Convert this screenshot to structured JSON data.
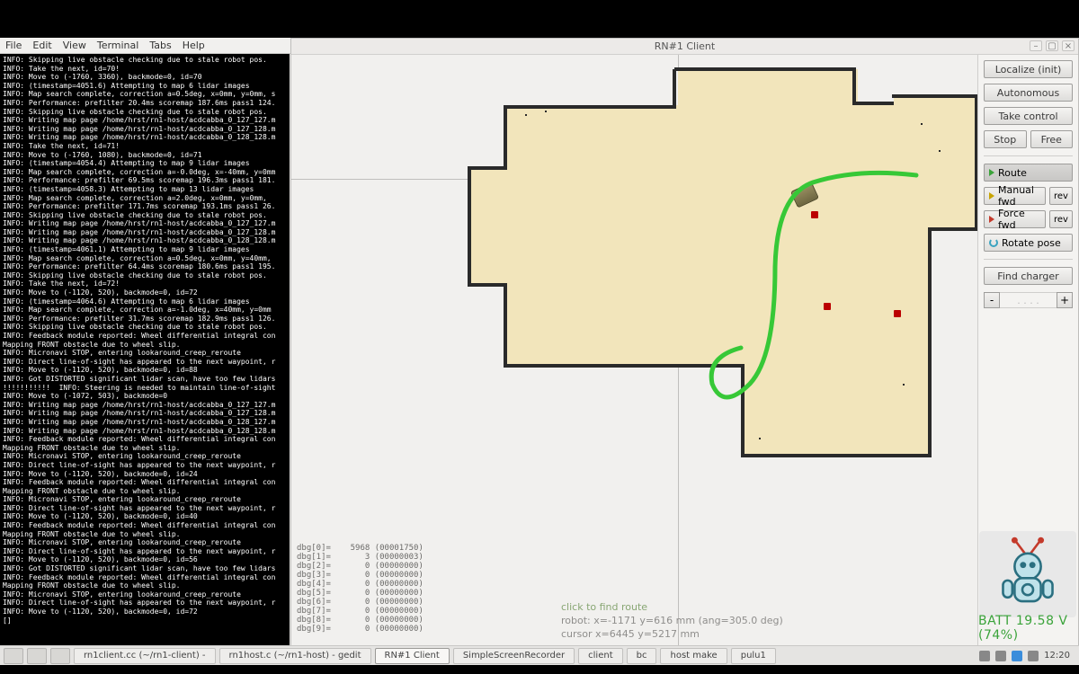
{
  "menubar": [
    "File",
    "Edit",
    "View",
    "Terminal",
    "Tabs",
    "Help"
  ],
  "client_title": "RN#1 Client",
  "terminal_log": "INFO: Skipping live obstacle checking due to stale robot pos.\nINFO: Take the next, id=70!\nINFO: Move to (-1760, 3360), backmode=0, id=70\nINFO: (timestamp=4051.6) Attempting to map 6 lidar images\nINFO: Map search complete, correction a=0.5deg, x=0mm, y=0mm, s\nINFO: Performance: prefilter 20.4ms scoremap 187.6ms pass1 124.\nINFO: Skipping live obstacle checking due to stale robot pos.\nINFO: Writing map page /home/hrst/rn1-host/acdcabba_0_127_127.m\nINFO: Writing map page /home/hrst/rn1-host/acdcabba_0_127_128.m\nINFO: Writing map page /home/hrst/rn1-host/acdcabba_0_128_128.m\nINFO: Take the next, id=71!\nINFO: Move to (-1760, 1080), backmode=0, id=71\nINFO: (timestamp=4054.4) Attempting to map 9 lidar images\nINFO: Map search complete, correction a=-0.0deg, x=-40mm, y=0mm\nINFO: Performance: prefilter 69.5ms scoremap 196.3ms pass1 181.\nINFO: (timestamp=4058.3) Attempting to map 13 lidar images\nINFO: Map search complete, correction a=2.0deg, x=0mm, y=0mm,\nINFO: Performance: prefilter 171.7ms scoremap 193.1ms pass1 26.\nINFO: Skipping live obstacle checking due to stale robot pos.\nINFO: Writing map page /home/hrst/rn1-host/acdcabba_0_127_127.m\nINFO: Writing map page /home/hrst/rn1-host/acdcabba_0_127_128.m\nINFO: Writing map page /home/hrst/rn1-host/acdcabba_0_128_128.m\nINFO: (timestamp=4061.1) Attempting to map 9 lidar images\nINFO: Map search complete, correction a=0.5deg, x=0mm, y=40mm,\nINFO: Performance: prefilter 64.4ms scoremap 180.6ms pass1 195.\nINFO: Skipping live obstacle checking due to stale robot pos.\nINFO: Take the next, id=72!\nINFO: Move to (-1120, 520), backmode=0, id=72\nINFO: (timestamp=4064.6) Attempting to map 6 lidar images\nINFO: Map search complete, correction a=-1.0deg, x=40mm, y=0mm\nINFO: Performance: prefilter 31.7ms scoremap 182.9ms pass1 126.\nINFO: Skipping live obstacle checking due to stale robot pos.\nINFO: Feedback module reported: Wheel differential integral con\nMapping FRONT obstacle due to wheel slip.\nINFO: Micronavi STOP, entering lookaround_creep_reroute\nINFO: Direct line-of-sight has appeared to the next waypoint, r\nINFO: Move to (-1120, 520), backmode=0, id=88\nINFO: Got DISTORTED significant lidar scan, have too few lidars\n!!!!!!!!!!!  INFO: Steering is needed to maintain line-of-sight\nINFO: Move to (-1072, 503), backmode=0\nINFO: Writing map page /home/hrst/rn1-host/acdcabba_0_127_127.m\nINFO: Writing map page /home/hrst/rn1-host/acdcabba_0_127_128.m\nINFO: Writing map page /home/hrst/rn1-host/acdcabba_0_128_127.m\nINFO: Writing map page /home/hrst/rn1-host/acdcabba_0_128_128.m\nINFO: Feedback module reported: Wheel differential integral con\nMapping FRONT obstacle due to wheel slip.\nINFO: Micronavi STOP, entering lookaround_creep_reroute\nINFO: Direct line-of-sight has appeared to the next waypoint, r\nINFO: Move to (-1120, 520), backmode=0, id=24\nINFO: Feedback module reported: Wheel differential integral con\nMapping FRONT obstacle due to wheel slip.\nINFO: Micronavi STOP, entering lookaround_creep_reroute\nINFO: Direct line-of-sight has appeared to the next waypoint, r\nINFO: Move to (-1120, 520), backmode=0, id=40\nINFO: Feedback module reported: Wheel differential integral con\nMapping FRONT obstacle due to wheel slip.\nINFO: Micronavi STOP, entering lookaround_creep_reroute\nINFO: Direct line-of-sight has appeared to the next waypoint, r\nINFO: Move to (-1120, 520), backmode=0, id=56\nINFO: Got DISTORTED significant lidar scan, have too few lidars\nINFO: Feedback module reported: Wheel differential integral con\nMapping FRONT obstacle due to wheel slip.\nINFO: Micronavi STOP, entering lookaround_creep_reroute\nINFO: Direct line-of-sight has appeared to the next waypoint, r\nINFO: Move to (-1120, 520), backmode=0, id=72\n[]",
  "dbg": [
    "dbg[0]=    5968 (00001750)",
    "dbg[1]=       3 (00000003)",
    "dbg[2]=       0 (00000000)",
    "dbg[3]=       0 (00000000)",
    "dbg[4]=       0 (00000000)",
    "dbg[5]=       0 (00000000)",
    "dbg[6]=       0 (00000000)",
    "dbg[7]=       0 (00000000)",
    "dbg[8]=       0 (00000000)",
    "dbg[9]=       0 (00000000)"
  ],
  "status": {
    "hint": "click to find route",
    "robot": "robot: x=-1171  y=616  mm  (ang=305.0 deg)",
    "cursor": "cursor x=6445  y=5217  mm"
  },
  "ctrl": {
    "localize": "Localize (init)",
    "autonomous": "Autonomous",
    "takecontrol": "Take control",
    "stop": "Stop",
    "free": "Free",
    "route": "Route",
    "manualfwd": "Manual fwd",
    "forcefwd": "Force fwd",
    "rotatepose": "Rotate pose",
    "rev": "rev",
    "findcharger": "Find charger",
    "minus": "-",
    "plus": "+",
    "dots": ". . . ."
  },
  "batt": "BATT 19.58 V (74%)",
  "taskbar": {
    "items": [
      "rn1client.cc (~/rn1-client) - ",
      "rn1host.c (~/rn1-host) - gedit",
      "RN#1 Client",
      "SimpleScreenRecorder",
      "client",
      "bc",
      "host make",
      "pulu1"
    ],
    "clock": "12:20"
  }
}
